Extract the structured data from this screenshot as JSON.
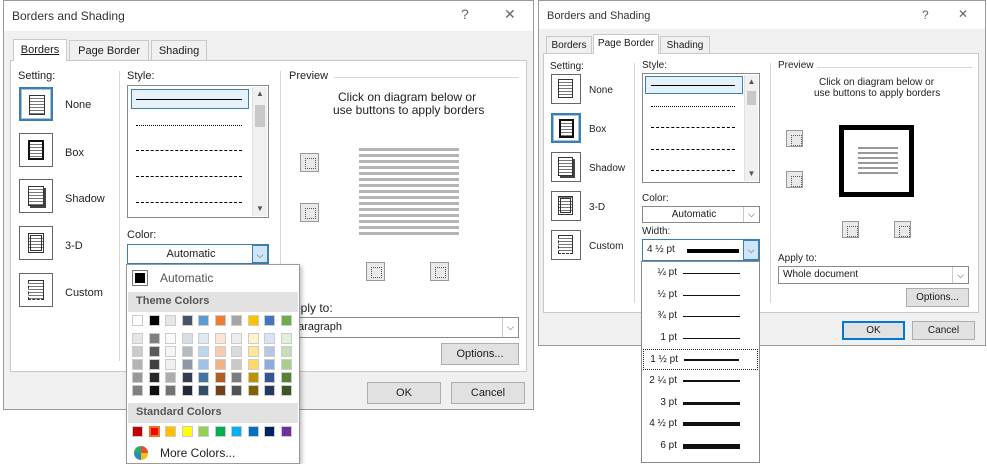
{
  "left_dialog": {
    "title": "Borders and Shading",
    "help_icon": "?",
    "close_icon": "✕",
    "tabs": [
      "Borders",
      "Page Border",
      "Shading"
    ],
    "setting_label": "Setting:",
    "settings": [
      "None",
      "Box",
      "Shadow",
      "3-D",
      "Custom"
    ],
    "style_label": "Style:",
    "color_label": "Color:",
    "color_value": "Automatic",
    "preview_label": "Preview",
    "preview_hint_1": "Click on diagram below or",
    "preview_hint_2": "use buttons to apply borders",
    "apply_to_label": "pply to:",
    "apply_to_value": "aragraph",
    "options_button": "Options...",
    "ok_button": "OK",
    "cancel_button": "Cancel"
  },
  "color_menu": {
    "automatic_label": "Automatic",
    "theme_colors_header": "Theme Colors",
    "theme_top_row": [
      "#ffffff",
      "#000000",
      "#e7e6e6",
      "#44546a",
      "#5b9bd5",
      "#ed7d31",
      "#a5a5a5",
      "#ffc000",
      "#4472c4",
      "#70ad47"
    ],
    "standard_colors_header": "Standard Colors",
    "standard_colors": [
      "#c00000",
      "#ff0000",
      "#ffc000",
      "#ffff00",
      "#92d050",
      "#00b050",
      "#00b0f0",
      "#0070c0",
      "#002060",
      "#7030a0"
    ],
    "more_colors_label": "More Colors..."
  },
  "right_dialog": {
    "title": "Borders and Shading",
    "help_icon": "?",
    "close_icon": "✕",
    "tabs": [
      "Borders",
      "Page Border",
      "Shading"
    ],
    "setting_label": "Setting:",
    "settings": [
      "None",
      "Box",
      "Shadow",
      "3-D",
      "Custom"
    ],
    "style_label": "Style:",
    "color_label": "Color:",
    "color_value": "Automatic",
    "width_label": "Width:",
    "width_value": "4 ½ pt",
    "preview_label": "Preview",
    "preview_hint_1": "Click on diagram below or",
    "preview_hint_2": "use buttons to apply borders",
    "apply_to_label": "Apply to:",
    "apply_to_value": "Whole document",
    "options_button": "Options...",
    "ok_button": "OK",
    "cancel_button": "Cancel"
  },
  "width_list": {
    "items": [
      "¼ pt",
      "½ pt",
      "¾ pt",
      "1 pt",
      "1 ½ pt",
      "2 ¼ pt",
      "3 pt",
      "4 ½ pt",
      "6 pt"
    ],
    "selected": "1 ½ pt"
  }
}
